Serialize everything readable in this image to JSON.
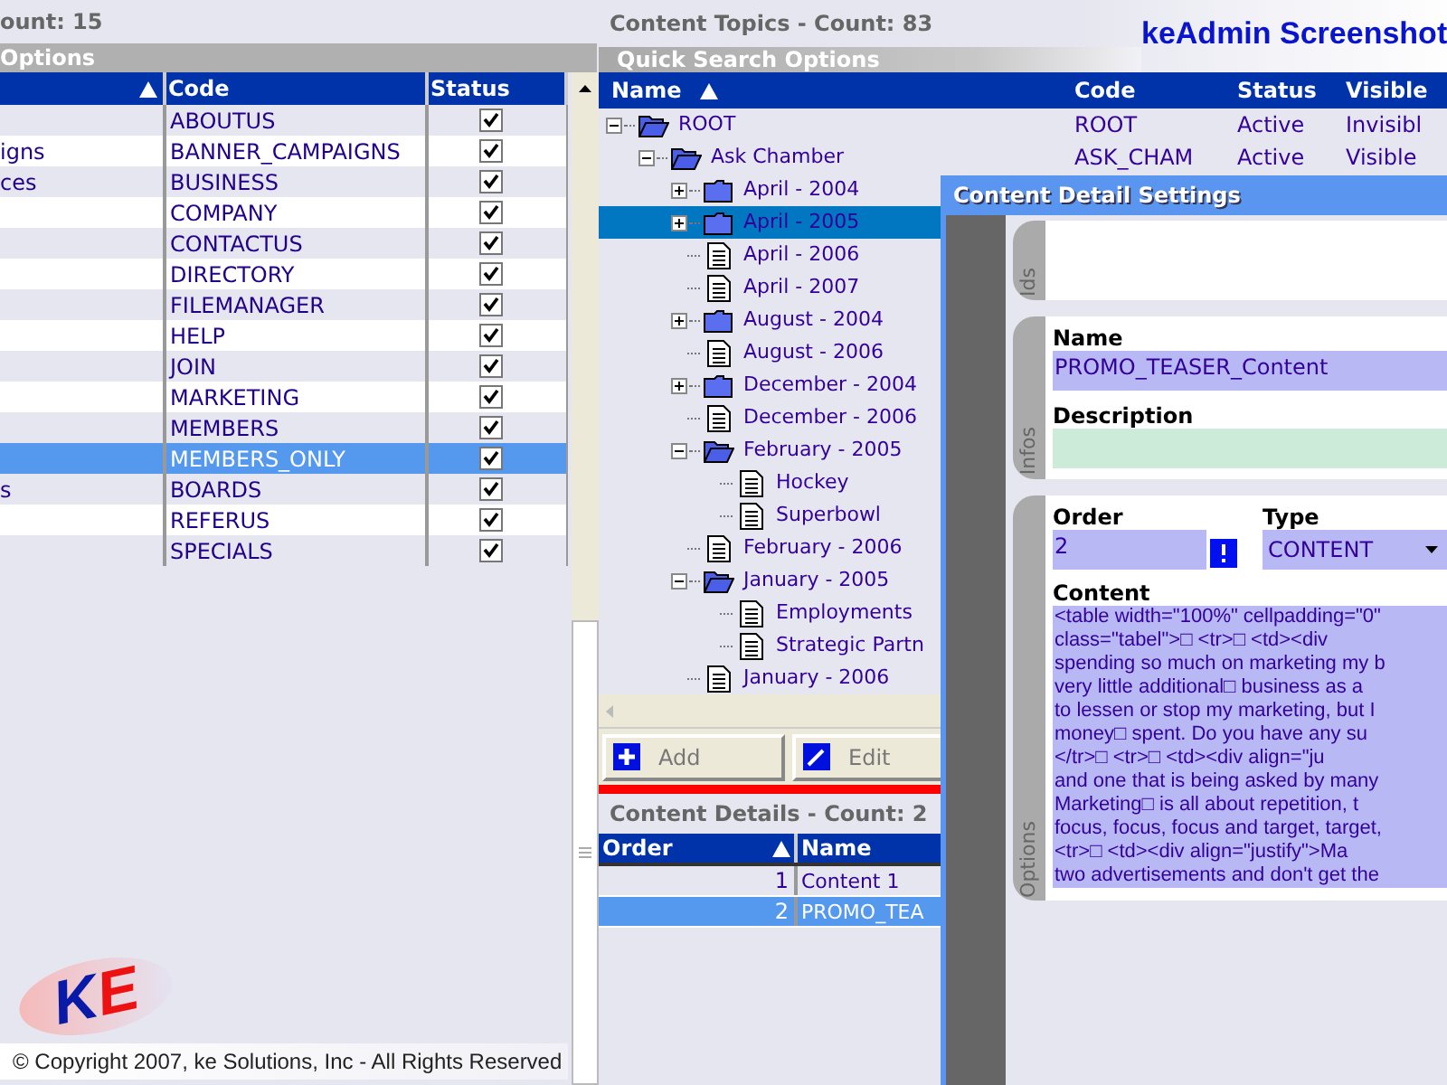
{
  "left_panel": {
    "count_label": "ount: 15",
    "section_title": "Options",
    "columns": [
      {
        "sorted": true
      },
      {
        "label": "Code",
        "sorted": false
      },
      {
        "label": "Status",
        "sorted": false
      }
    ],
    "rows": [
      {
        "code": "ABOUTUS",
        "checked": true,
        "selected": false
      },
      {
        "name": "igns",
        "code": "BANNER_CAMPAIGNS",
        "checked": true,
        "selected": false
      },
      {
        "name": "ces",
        "code": "BUSINESS",
        "checked": true,
        "selected": false
      },
      {
        "code": "COMPANY",
        "checked": true,
        "selected": false
      },
      {
        "code": "CONTACTUS",
        "checked": true,
        "selected": false
      },
      {
        "code": "DIRECTORY",
        "checked": true,
        "selected": false
      },
      {
        "code": "FILEMANAGER",
        "checked": true,
        "selected": false
      },
      {
        "code": "HELP",
        "checked": true,
        "selected": false
      },
      {
        "code": "JOIN",
        "checked": true,
        "selected": false
      },
      {
        "code": "MARKETING",
        "checked": true,
        "selected": false
      },
      {
        "code": "MEMBERS",
        "checked": true,
        "selected": false
      },
      {
        "code": "MEMBERS_ONLY",
        "checked": true,
        "selected": true
      },
      {
        "name": "s",
        "code": "BOARDS",
        "checked": true,
        "selected": false
      },
      {
        "code": "REFERUS",
        "checked": true,
        "selected": false
      },
      {
        "code": "SPECIALS",
        "checked": true,
        "selected": false
      }
    ],
    "logo": {
      "letters": [
        "K",
        "E"
      ]
    },
    "copyright": "© Copyright 2007, ke Solutions, Inc - All Rights Reserved"
  },
  "topics": {
    "title": "Content Topics - Count: 83",
    "brand": "keAdmin Screenshot",
    "search_bar": "Quick Search Options",
    "columns": [
      {
        "label": "Name",
        "sorted": true
      },
      {
        "label": "Code",
        "sorted": false
      },
      {
        "label": "Status",
        "sorted": false
      },
      {
        "label": "Visible",
        "sorted": false
      }
    ],
    "tree": [
      {
        "label": "ROOT",
        "kind": "folder",
        "expanded": true,
        "selected": false,
        "code": "ROOT",
        "status": "Active",
        "visible": "Invisibl",
        "children": [
          {
            "label": "Ask Chamber",
            "kind": "folder",
            "expanded": true,
            "selected": false,
            "code": "ASK_CHAM",
            "status": "Active",
            "visible": "Visible",
            "children": [
              {
                "label": "April - 2004",
                "kind": "folder",
                "expanded": false,
                "selected": false
              },
              {
                "label": "April - 2005",
                "kind": "folder",
                "expanded": false,
                "selected": true
              },
              {
                "label": "April - 2006",
                "kind": "document",
                "selected": false
              },
              {
                "label": "April - 2007",
                "kind": "document",
                "selected": false
              },
              {
                "label": "August - 2004",
                "kind": "folder",
                "expanded": false,
                "selected": false
              },
              {
                "label": "August - 2006",
                "kind": "document",
                "selected": false
              },
              {
                "label": "December - 2004",
                "kind": "folder",
                "expanded": false,
                "selected": false
              },
              {
                "label": "December - 2006",
                "kind": "document",
                "selected": false
              },
              {
                "label": "February - 2005",
                "kind": "folder",
                "expanded": true,
                "selected": false,
                "children": [
                  {
                    "label": "Hockey",
                    "kind": "document",
                    "selected": false
                  },
                  {
                    "label": "Superbowl",
                    "kind": "document",
                    "selected": false
                  }
                ]
              },
              {
                "label": "February - 2006",
                "kind": "document",
                "selected": false
              },
              {
                "label": "January - 2005",
                "kind": "folder",
                "expanded": true,
                "selected": false,
                "children": [
                  {
                    "label": "Employments",
                    "kind": "document",
                    "selected": false
                  },
                  {
                    "label": "Strategic Partn",
                    "kind": "document",
                    "selected": false
                  }
                ]
              },
              {
                "label": "January - 2006",
                "kind": "document",
                "selected": false
              }
            ]
          }
        ]
      }
    ],
    "buttons": [
      {
        "label": "Add",
        "kind": "add"
      },
      {
        "label": "Edit",
        "kind": "edit"
      }
    ]
  },
  "details": {
    "title": "Content Details - Count: 2",
    "columns": [
      {
        "label": "Order",
        "sorted": true
      },
      {
        "label": "Name",
        "sorted": false
      }
    ],
    "rows": [
      {
        "order": "1",
        "name": "Content 1",
        "selected": false
      },
      {
        "order": "2",
        "name": "PROMO_TEA",
        "selected": true
      }
    ]
  },
  "dialog": {
    "title": "Content Detail Settings",
    "ids_tab": "Ids",
    "infos_tab": "Infos",
    "options_tab": "Options",
    "name_label": "Name",
    "name_value": "PROMO_TEASER_Content",
    "description_label": "Description",
    "order_label": "Order",
    "order_value": "2",
    "type_label": "Type",
    "type_value": "CONTENT",
    "content_label": "Content",
    "content_lines": [
      "<table width=\"100%\" cellpadding=\"0\"",
      "class=\"tabel\">□ <tr>□ <td><div",
      "spending so much on marketing my b",
      "very little additional□ business as a",
      "to lessen or stop my marketing, but I",
      "money□ spent. Do you have any su",
      "</tr>□ <tr>□ <td><div align=\"ju",
      "and one that is being asked by many",
      "Marketing□ is all about repetition, t",
      "focus, focus, focus and target, target,",
      "<tr>□ <td><div align=\"justify\">Ma",
      "two advertisements and don't get the"
    ]
  }
}
